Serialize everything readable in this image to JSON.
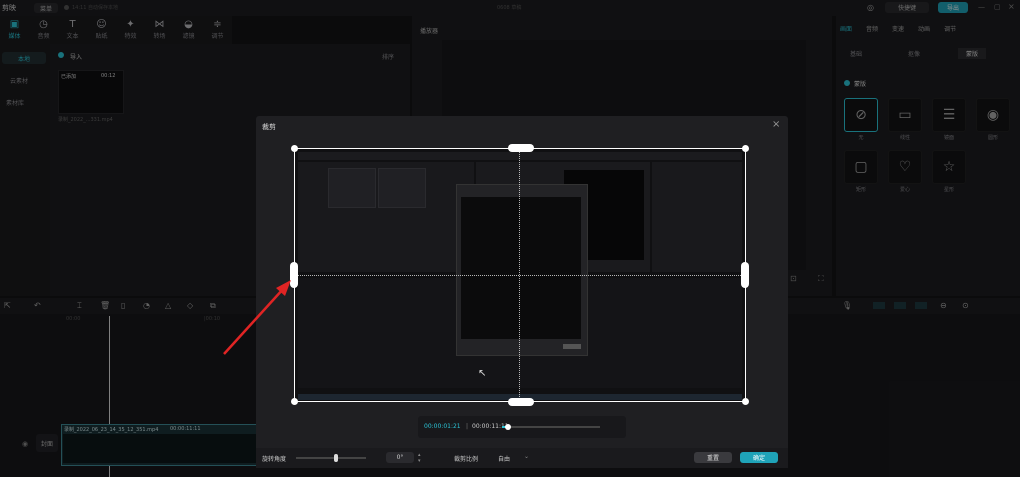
{
  "app": {
    "title": "剪映",
    "menu_label": "菜单",
    "autosave": "14:11 自动保存本地",
    "project_name": "0608 草稿",
    "shortcut_label": "快捷键",
    "export_label": "导出"
  },
  "toolbar": {
    "items": [
      {
        "label": "媒体",
        "icon": "▣"
      },
      {
        "label": "音频",
        "icon": "◷"
      },
      {
        "label": "文本",
        "icon": "T"
      },
      {
        "label": "贴纸",
        "icon": "☺"
      },
      {
        "label": "特效",
        "icon": "✦"
      },
      {
        "label": "转场",
        "icon": "⋈"
      },
      {
        "label": "滤镜",
        "icon": "◒"
      },
      {
        "label": "调节",
        "icon": "≑"
      }
    ]
  },
  "media": {
    "sidebar": [
      "本地",
      "云素材",
      "素材库"
    ],
    "import_label": "导入",
    "sort_label": "排序",
    "clip_added": "已添加",
    "clip_duration": "00:12",
    "clip_name": "录制_2022_...331.mp4"
  },
  "preview": {
    "title": "播放器"
  },
  "right_panel": {
    "tabs": [
      "画面",
      "音频",
      "变速",
      "动画",
      "调节"
    ],
    "subtabs": [
      "基础",
      "抠像",
      "蒙版"
    ],
    "mask_label": "蒙版",
    "masks": [
      "无",
      "线性",
      "镜面",
      "圆形",
      "矩形",
      "爱心",
      "星形"
    ]
  },
  "timeline": {
    "ruler": [
      "00:00",
      "|00:10"
    ],
    "track_label": "封面",
    "clip_label": "录制_2022_06_23_14_35_12_351.mp4",
    "clip_duration": "00:00:11:11"
  },
  "crop_dialog": {
    "title": "裁剪",
    "close_icon": "×",
    "time_current": "00:00:01:21",
    "time_total": "00:00:11:11",
    "playhead_fraction": 0.06,
    "rotate_label": "旋转角度",
    "rotate_value": "0°",
    "ratio_label": "裁剪比例",
    "ratio_value": "自由",
    "reset_label": "重置",
    "confirm_label": "确定"
  },
  "colors": {
    "accent": "#2bc4d6",
    "arrow": "#e02424",
    "export": "#1fa3b8"
  }
}
